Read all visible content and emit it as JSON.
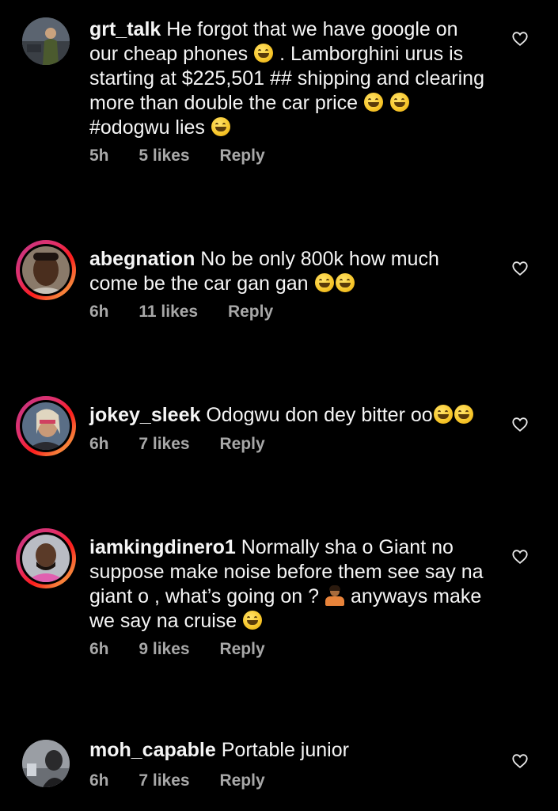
{
  "comments": [
    {
      "username": "grt_talk",
      "segments": [
        "He forgot that we have google on our cheap phones",
        ". Lamborghini urus is starting at $225,501 ## shipping and clearing more than double the car price",
        "",
        "#odogwu lies",
        ""
      ],
      "time": "5h",
      "likes": "5 likes",
      "reply": "Reply",
      "avatar_ring": false
    },
    {
      "username": "abegnation",
      "segments": [
        "No be only 800k how much come be the car gan gan"
      ],
      "time": "6h",
      "likes": "11 likes",
      "reply": "Reply",
      "avatar_ring": true
    },
    {
      "username": "jokey_sleek",
      "segments": [
        "Odogwu don dey bitter oo"
      ],
      "time": "6h",
      "likes": "7 likes",
      "reply": "Reply",
      "avatar_ring": true
    },
    {
      "username": "iamkingdinero1",
      "segments": [
        "Normally sha o Giant no suppose make noise before them see say na giant o , what’s going on ?",
        "anyways make we say na cruise"
      ],
      "time": "6h",
      "likes": "9 likes",
      "reply": "Reply",
      "avatar_ring": true
    },
    {
      "username": "moh_capable",
      "segments": [
        "Portable junior"
      ],
      "time": "6h",
      "likes": "7 likes",
      "reply": "Reply",
      "avatar_ring": false
    }
  ],
  "icons": {
    "like": "heart-outline-icon",
    "laugh": "grinning-squinting-face-emoji",
    "shrug": "person-shrugging-emoji"
  },
  "colors": {
    "background": "#000000",
    "text": "#f5f5f5",
    "meta": "#a8a8a8",
    "story_ring_start": "#c13584",
    "story_ring_end": "#fcaf45"
  }
}
